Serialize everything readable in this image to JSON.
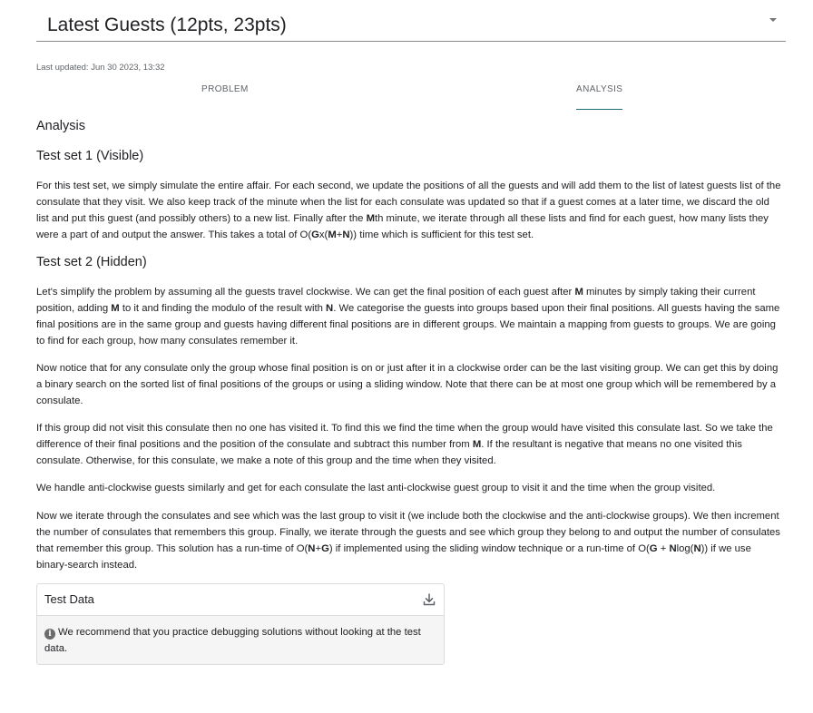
{
  "header": {
    "title": "Latest Guests (12pts, 23pts)"
  },
  "last_updated": "Last updated: Jun 30 2023, 13:32",
  "tabs": [
    {
      "label": "PROBLEM"
    },
    {
      "label": "ANALYSIS"
    }
  ],
  "analysis": {
    "heading": "Analysis",
    "test_set_1": {
      "heading": "Test set 1 (Visible)",
      "paragraph": [
        {
          "t": "For this test set, we simply simulate the entire affair. For each second, we update the positions of all the guests and will add them to the list of latest guests list of the consulate that they visit. We also keep track of the minute when the list for each consulate was updated so that if a guest comes at a later time, we discard the old list and put this guest (and possibly others) to a new list. Finally after the "
        },
        {
          "b": "M"
        },
        {
          "t": "th minute, we iterate through all these lists and find for each guest, how many lists they were a part of and output the answer. This takes a total of O("
        },
        {
          "b": "G"
        },
        {
          "t": "x("
        },
        {
          "b": "M"
        },
        {
          "t": "+"
        },
        {
          "b": "N"
        },
        {
          "t": ")) time which is sufficient for this test set."
        }
      ]
    },
    "test_set_2": {
      "heading": "Test set 2 (Hidden)",
      "paragraphs": [
        [
          {
            "t": "Let's simplify the problem by assuming all the guests travel clockwise. We can get the final position of each guest after "
          },
          {
            "b": "M"
          },
          {
            "t": " minutes by simply taking their current position, adding "
          },
          {
            "b": "M"
          },
          {
            "t": " to it and finding the modulo of the result with "
          },
          {
            "b": "N"
          },
          {
            "t": ". We categorise the guests into groups based upon their final positions. All guests having the same final positions are in the same group and guests having different final positions are in different groups. We maintain a mapping from guests to groups. We are going to find for each group, how many consulates remember it."
          }
        ],
        [
          {
            "t": "Now notice that for any consulate only the group whose final position is on or just after it in a clockwise order can be the last visiting group. We can get this by doing a binary search on the sorted list of final positions of the groups or using a sliding window. Note that there can be at most one group which will be remembered by a consulate."
          }
        ],
        [
          {
            "t": "If this group did not visit this consulate then no one has visited it. To find this we find the time when the group would have visited this consulate last. So we take the difference of their final positions and the position of the consulate and subtract this number from "
          },
          {
            "b": "M"
          },
          {
            "t": ". If the resultant is negative that means no one visited this consulate. Otherwise, for this consulate, we make a note of this group and the time when they visited."
          }
        ],
        [
          {
            "t": "We handle anti-clockwise guests similarly and get for each consulate the last anti-clockwise guest group to visit it and the time when the group visited."
          }
        ],
        [
          {
            "t": "Now we iterate through the consulates and see which was the last group to visit it (we include both the clockwise and the anti-clockwise groups). We then increment the number of consulates that remembers this group. Finally, we iterate through the guests and see which group they belong to and output the number of consulates that remember this group. This solution has a run-time of O("
          },
          {
            "b": "N"
          },
          {
            "t": "+"
          },
          {
            "b": "G"
          },
          {
            "t": ") if implemented using the sliding window technique or a run-time of O("
          },
          {
            "b": "G"
          },
          {
            "t": " + "
          },
          {
            "b": "N"
          },
          {
            "t": "log("
          },
          {
            "b": "N"
          },
          {
            "t": ")) if we use binary-search instead."
          }
        ]
      ]
    }
  },
  "test_data": {
    "title": "Test Data",
    "note": "We recommend that you practice debugging solutions without looking at the test data.",
    "icons": {
      "download": "download-icon",
      "info": "info-icon"
    }
  },
  "colors": {
    "accent": "#1a6e7a",
    "divider": "#8a8a8a",
    "card_bg": "#f5f5f5"
  }
}
